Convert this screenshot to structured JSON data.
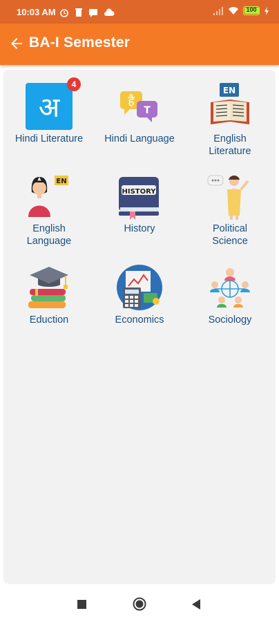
{
  "status_bar": {
    "time": "10:03 AM",
    "battery": "100"
  },
  "app_bar": {
    "title": "BA-I Semester"
  },
  "subjects": [
    {
      "label": "Hindi Literature",
      "icon": "hindi-letter-icon",
      "badge": "4"
    },
    {
      "label": "Hindi Language",
      "icon": "language-chat-icon"
    },
    {
      "label": "English\nLiterature",
      "icon": "book-en-icon"
    },
    {
      "label": "English\nLanguage",
      "icon": "teacher-en-icon"
    },
    {
      "label": "History",
      "icon": "history-book-icon"
    },
    {
      "label": "Political\nScience",
      "icon": "speaker-podium-icon"
    },
    {
      "label": "Eduction",
      "icon": "grad-cap-books-icon"
    },
    {
      "label": "Economics",
      "icon": "calculator-chart-icon"
    },
    {
      "label": "Sociology",
      "icon": "people-network-icon"
    }
  ],
  "colors": {
    "status_bar": "#e0672a",
    "app_bar": "#f57a26",
    "label": "#1a4f80",
    "panel": "#f2f2f2",
    "badge": "#e53935"
  }
}
